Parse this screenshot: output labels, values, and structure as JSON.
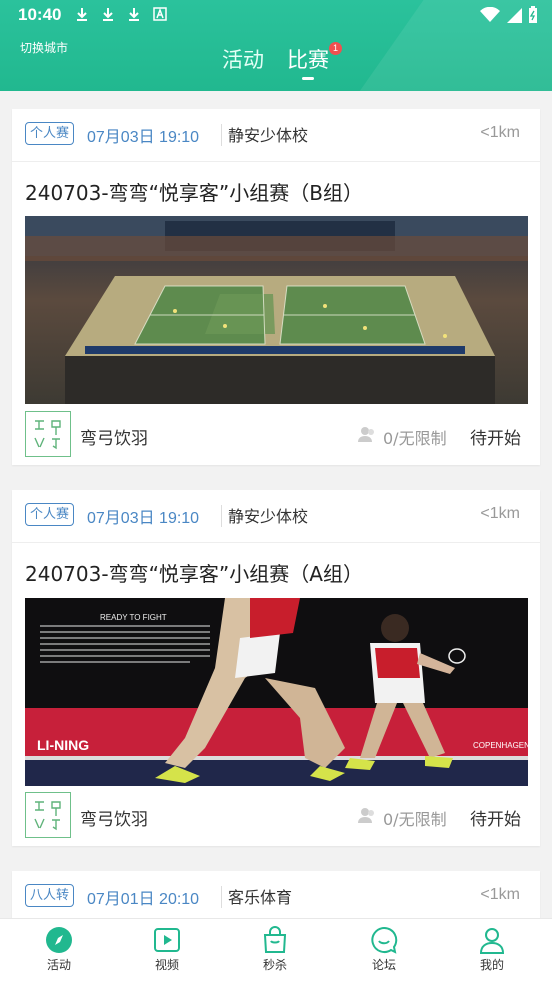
{
  "status_bar": {
    "time": "10:40"
  },
  "header": {
    "city_label": "切换城市",
    "tabs": [
      {
        "label": "活动"
      },
      {
        "label": "比赛"
      }
    ],
    "badge_count": "1"
  },
  "cards": [
    {
      "tag": "个人赛",
      "datetime": "07月03日 19:10",
      "venue": "静安少体校",
      "distance": "<1km",
      "title": "240703-弯弯“悦享客”小组赛（B组）",
      "organizer": "弯弓饮羽",
      "capacity": "0/无限制",
      "status": "待开始"
    },
    {
      "tag": "个人赛",
      "datetime": "07月03日 19:10",
      "venue": "静安少体校",
      "distance": "<1km",
      "title": "240703-弯弯“悦享客”小组赛（A组）",
      "organizer": "弯弓饮羽",
      "capacity": "0/无限制",
      "status": "待开始",
      "photo_text": {
        "headline": "READY TO FIGHT",
        "banner": "LI-NING",
        "sub": "COPENHAGEN"
      }
    },
    {
      "tag": "八人转",
      "datetime": "07月01日 20:10",
      "venue": "客乐体育",
      "distance": "<1km"
    }
  ],
  "bottom_nav": [
    {
      "label": "活动",
      "icon": "compass-icon"
    },
    {
      "label": "视频",
      "icon": "video-play-icon"
    },
    {
      "label": "秒杀",
      "icon": "shopping-bag-icon"
    },
    {
      "label": "论坛",
      "icon": "chat-smile-icon"
    },
    {
      "label": "我的",
      "icon": "user-icon"
    }
  ],
  "colors": {
    "accent": "#21b88f",
    "tag": "#4a87c4"
  }
}
